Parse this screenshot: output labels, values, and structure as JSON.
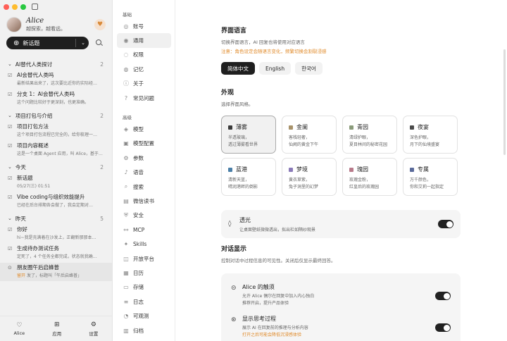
{
  "profile": {
    "name": "Alice",
    "tagline": "越探索，越看远。"
  },
  "new_chat": {
    "label": "新话题"
  },
  "groups": [
    {
      "title": "AI替代人类探讨",
      "count": "2",
      "items": [
        {
          "title": "AI会替代人类吗",
          "sub": "最新结果出来了，这次要比近你的实际经…",
          "icon": "☑"
        },
        {
          "title": "分支 1：AI会替代人类吗",
          "sub": "这个问题比较好于更深刻，也更准确。",
          "icon": "☑"
        }
      ]
    },
    {
      "title": "项目打包与介绍",
      "count": "2",
      "items": [
        {
          "title": "项目打包方法",
          "sub": "这个项目打包流程已完全的，给你梳理一…",
          "icon": "☑"
        },
        {
          "title": "项目内容概述",
          "sub": "这是一个桌面 Agent 应用，叫 Alice，基于…",
          "icon": "☑"
        }
      ]
    },
    {
      "title": "今天",
      "count": "2",
      "items": [
        {
          "title": "新话题",
          "sub": "05/27(三) 01:51",
          "icon": "☑"
        },
        {
          "title": "Vibe coding与组织效能提升",
          "sub": "已经在后台排期各会做了，我会定期对…",
          "icon": "☑"
        }
      ]
    },
    {
      "title": "昨天",
      "count": "5",
      "items": [
        {
          "title": "你好",
          "sub": "hi~我是充满着在沙发上，正翻新那那本…",
          "icon": "☑"
        },
        {
          "title": "生成待办测试任务",
          "sub": "定死了，4 个任务全都完成，状态就我确…",
          "icon": "☑"
        },
        {
          "title": "朋友圈午后启蜂普",
          "sub_warn": "留开",
          "sub": "发了，标题叫「午后启蜂普」",
          "icon": "⊙"
        }
      ]
    }
  ],
  "bottom_nav": [
    {
      "label": "Alice",
      "icon": "♡"
    },
    {
      "label": "应用",
      "icon": "⊞"
    },
    {
      "label": "设置",
      "icon": "⚙"
    }
  ],
  "settings_nav": {
    "section1": "基础",
    "basic": [
      {
        "label": "账号",
        "icon": "◎"
      },
      {
        "label": "通用",
        "icon": "◉"
      },
      {
        "label": "权限",
        "icon": "◌"
      },
      {
        "label": "记忆",
        "icon": "◍"
      },
      {
        "label": "关于",
        "icon": "ⓘ"
      },
      {
        "label": "常见问题",
        "icon": "?"
      }
    ],
    "section2": "高级",
    "advanced": [
      {
        "label": "模型",
        "icon": "◈"
      },
      {
        "label": "模型配置",
        "icon": "▣"
      },
      {
        "label": "参数",
        "icon": "⚙"
      },
      {
        "label": "语音",
        "icon": "♪"
      },
      {
        "label": "搜索",
        "icon": "⌕"
      },
      {
        "label": "微信读书",
        "icon": "▤"
      },
      {
        "label": "安全",
        "icon": "⛨"
      },
      {
        "label": "MCP",
        "icon": "⚯"
      },
      {
        "label": "Skills",
        "icon": "✦"
      },
      {
        "label": "开放平台",
        "icon": "◫"
      },
      {
        "label": "日历",
        "icon": "▦"
      },
      {
        "label": "存储",
        "icon": "▭"
      },
      {
        "label": "日志",
        "icon": "≡"
      },
      {
        "label": "可观测",
        "icon": "◔"
      },
      {
        "label": "归档",
        "icon": "▥"
      }
    ]
  },
  "language": {
    "title": "界面语言",
    "desc": "切换界面语言，AI 回复也将使用对应语言",
    "warn": "注意：角色设定会随语言变化，频繁切换会割裂浸感",
    "options": [
      "简体中文",
      "English",
      "한국어"
    ]
  },
  "appearance": {
    "title": "外观",
    "desc": "选择界面风格。",
    "themes": [
      {
        "name": "薄雾",
        "color": "#3a3a3a",
        "l1": "半透玻璃，",
        "l2": "透过薄雾看世界"
      },
      {
        "name": "金阑",
        "color": "#a8926a",
        "l1": "客栈轻奢，",
        "l2": "仙阙的黄金下午"
      },
      {
        "name": "青园",
        "color": "#8a9b7a",
        "l1": "清绿护眼，",
        "l2": "夏目林间的秘密花园"
      },
      {
        "name": "夜宴",
        "color": "#4a4a4a",
        "l1": "深色护眼，",
        "l2": "月下的仙境盛宴"
      },
      {
        "name": "蓝港",
        "color": "#4a7fa8",
        "l1": "清新天蓝，",
        "l2": "晴润港畔的倒影"
      },
      {
        "name": "梦境",
        "color": "#8a7ab8",
        "l1": "黄衣草紫，",
        "l2": "兔子洞里的幻梦"
      },
      {
        "name": "瑰园",
        "color": "#b87a8a",
        "l1": "玫瑰金粉，",
        "l2": "红皇后的玫瑰园"
      },
      {
        "name": "专属",
        "color": "#5a6a9a",
        "l1": "万千颜色，",
        "l2": "你和艾莉一起指定"
      }
    ],
    "transparency": {
      "title": "透光",
      "desc": "让桌面壁纸微微透出，拟出栏如隔纱观景"
    }
  },
  "dialog": {
    "title": "对话显示",
    "desc": "控制对话中过程信息的可见性。关闭后仅显示最终回答。",
    "items": [
      {
        "title": "Alice 的触须",
        "l1": "允许 Alice 偶尔在回复中加入内心独白",
        "l2": "推荐开启，提升产品体验",
        "icon": "⊝"
      },
      {
        "title": "显示思考过程",
        "l1": "展示 AI 在回复前的推理与分析内容",
        "l2": "打开之后可能会降低沉浸感体验",
        "icon": "⊛"
      }
    ]
  }
}
